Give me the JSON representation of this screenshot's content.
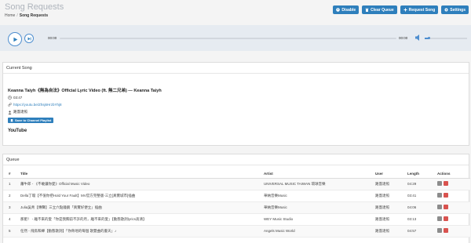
{
  "header": {
    "title": "Song Requests",
    "breadcrumb_home": "Home",
    "breadcrumb_sep": "/",
    "breadcrumb_current": "Song Requests"
  },
  "toolbar": {
    "disable_label": "Disable",
    "clear_queue_label": "Clear Queue",
    "request_song_label": "Request Song",
    "settings_label": "Settings"
  },
  "player": {
    "current_time": "00:00",
    "duration": "00:00",
    "volume_fraction": 0.1
  },
  "current_song": {
    "heading": "Current Song",
    "title": "Keanna Taiyh《無為自法》Official Lyric Video (ft. 無二兄弟) — Keanna Taiyh",
    "duration": "03:47",
    "url": "https://youtu.be/Zhsj6HrzbYhj8",
    "user": "路蓋達照",
    "save_label": "Save to Channel Playlist",
    "logo_you": "You",
    "logo_tube": "Tube"
  },
  "queue": {
    "heading": "Queue",
    "columns": [
      "#",
      "Title",
      "Artist",
      "User",
      "Length",
      "Actions"
    ],
    "rows": [
      {
        "num": "1",
        "title": "蕭牛郎 - 《不敢讓你愛》Official Music Video",
        "artist": "UNIVERSAL MUSIC TAIWAN 環球音樂",
        "user": "路蓋達照",
        "length": "04:29"
      },
      {
        "num": "2",
        "title": "Della丁噹【不值你把Hold Your Fault】MV官方完整版-三立[真實城市]插曲",
        "artist": "華納音樂Music",
        "user": "路蓋達照",
        "length": "03:41"
      },
      {
        "num": "3",
        "title": "Julia吳青【傳聲】三立六點鐘劇「真實好便立」插曲",
        "artist": "華納音樂Music",
        "user": "路蓋達照",
        "length": "04:06"
      },
      {
        "num": "4",
        "title": "那肥！ - 離不來的愛「你是我胸前不許的月，離不來的愛」【動態歌詞lyrics高清】",
        "artist": "WEY Music Studio",
        "user": "路蓋達照",
        "length": "03:13"
      },
      {
        "num": "5",
        "title": "任然 - 飛鳥和蟬【動態歌詞】「你骨地的每個 歌雙曲的書天」♪",
        "artist": "Angels Music World",
        "user": "路蓋達照",
        "length": "04:57"
      }
    ]
  },
  "colors": {
    "accent": "#2e7fbc",
    "delete": "#d9534f",
    "player_bg": "#e6ebf1"
  }
}
